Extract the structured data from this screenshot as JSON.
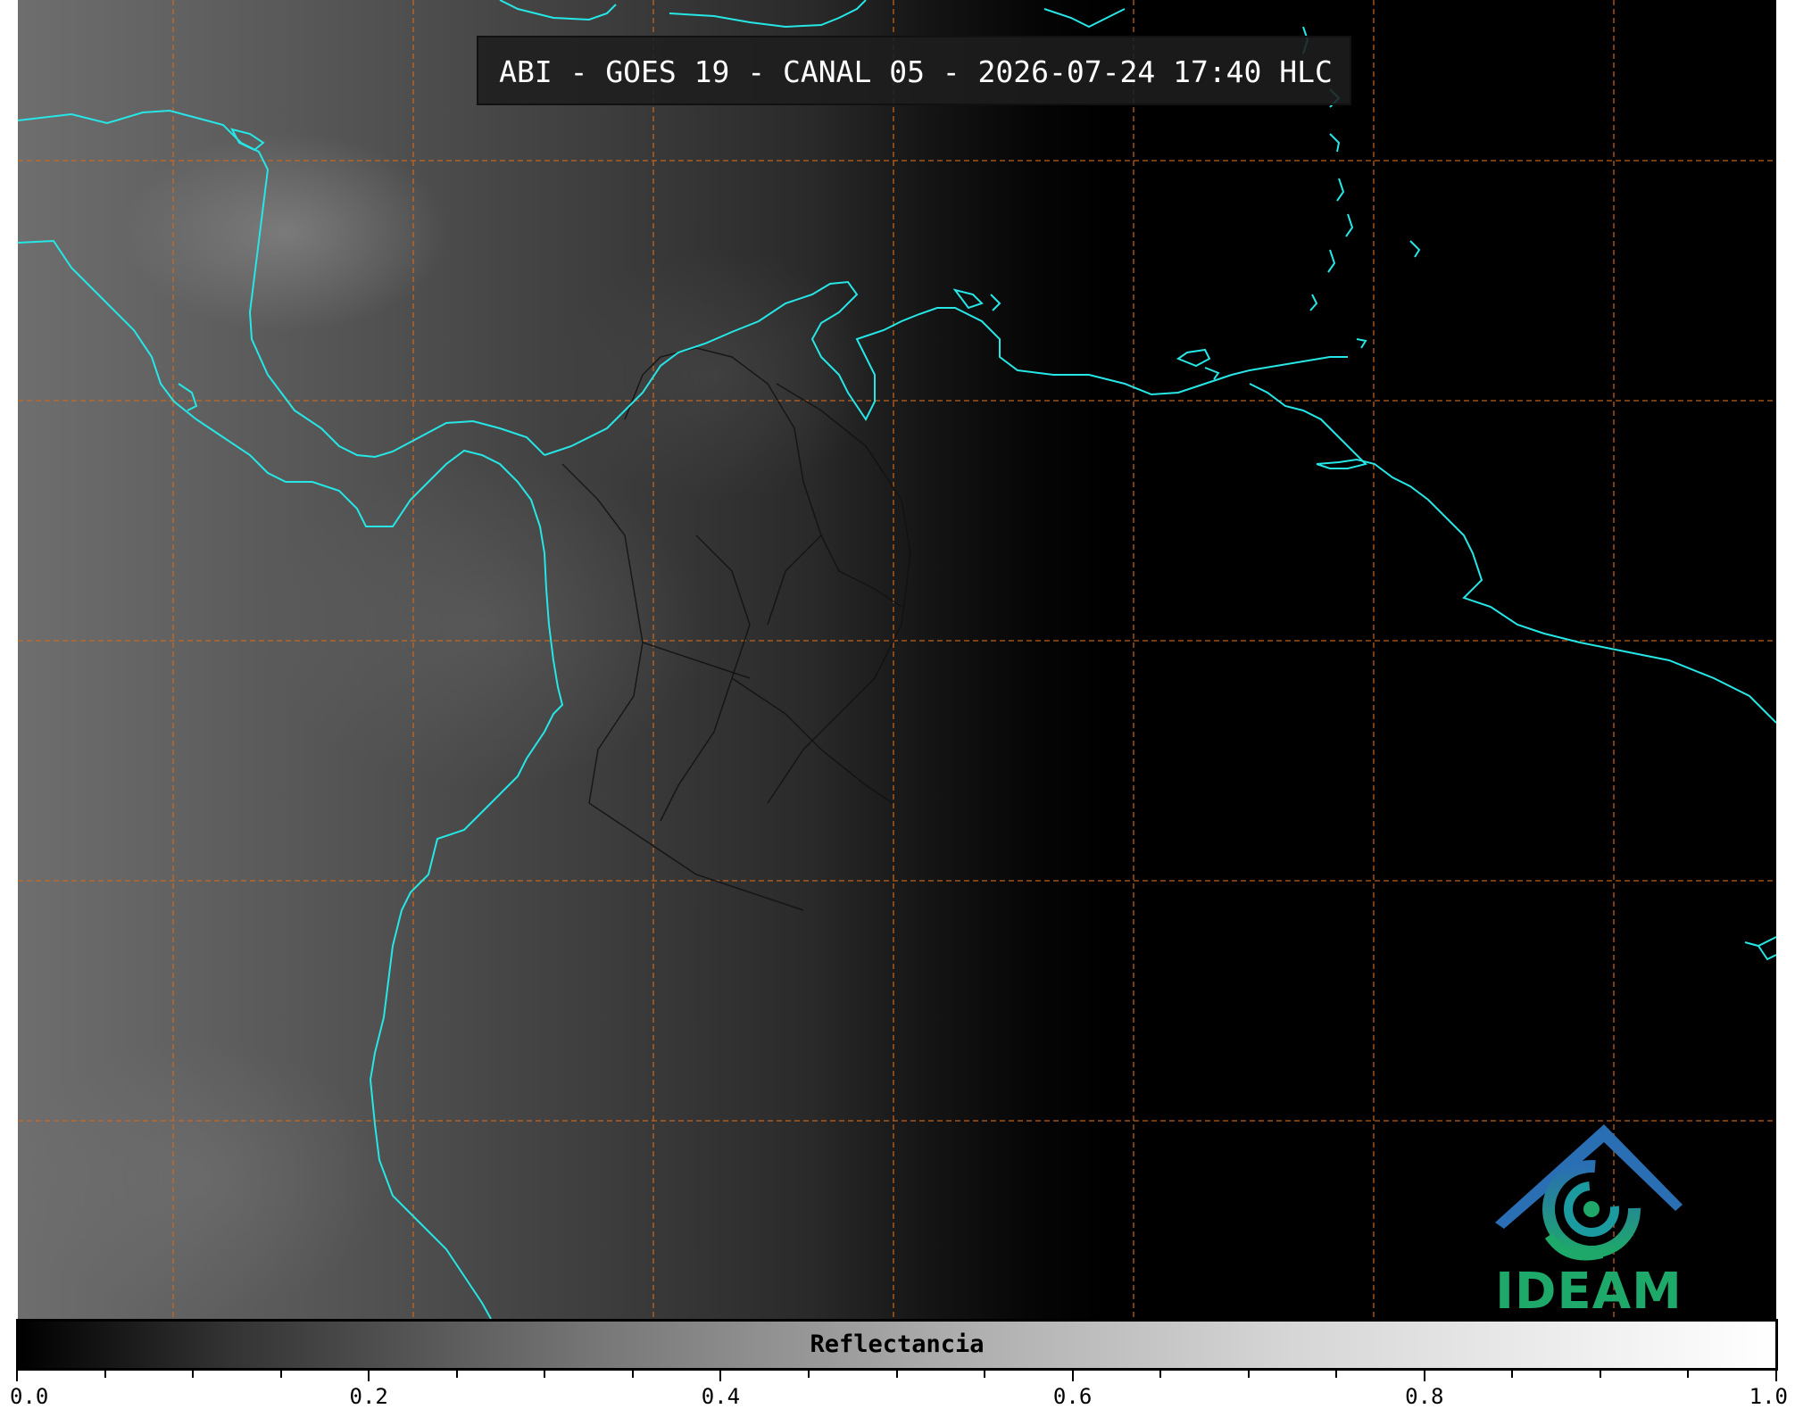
{
  "title": "ABI - GOES 19 - CANAL 05 - 2026-07-24 17:40 HLC",
  "logo": {
    "text": "IDEAM",
    "colors": {
      "blue": "#2a6fb3",
      "teal": "#1b9aa0",
      "green": "#1ea86a"
    }
  },
  "colorbar": {
    "label": "Reflectancia",
    "ticks": [
      {
        "value": 0.0,
        "label": "0.0"
      },
      {
        "value": 0.2,
        "label": "0.2"
      },
      {
        "value": 0.4,
        "label": "0.4"
      },
      {
        "value": 0.6,
        "label": "0.6"
      },
      {
        "value": 0.8,
        "label": "0.8"
      },
      {
        "value": 1.0,
        "label": "1.0"
      }
    ],
    "minor_step": 0.05,
    "range": [
      0.0,
      1.0
    ]
  },
  "colors": {
    "coastline": "#26e6e6",
    "gridline": "#d2691e",
    "borders": "#111111"
  }
}
